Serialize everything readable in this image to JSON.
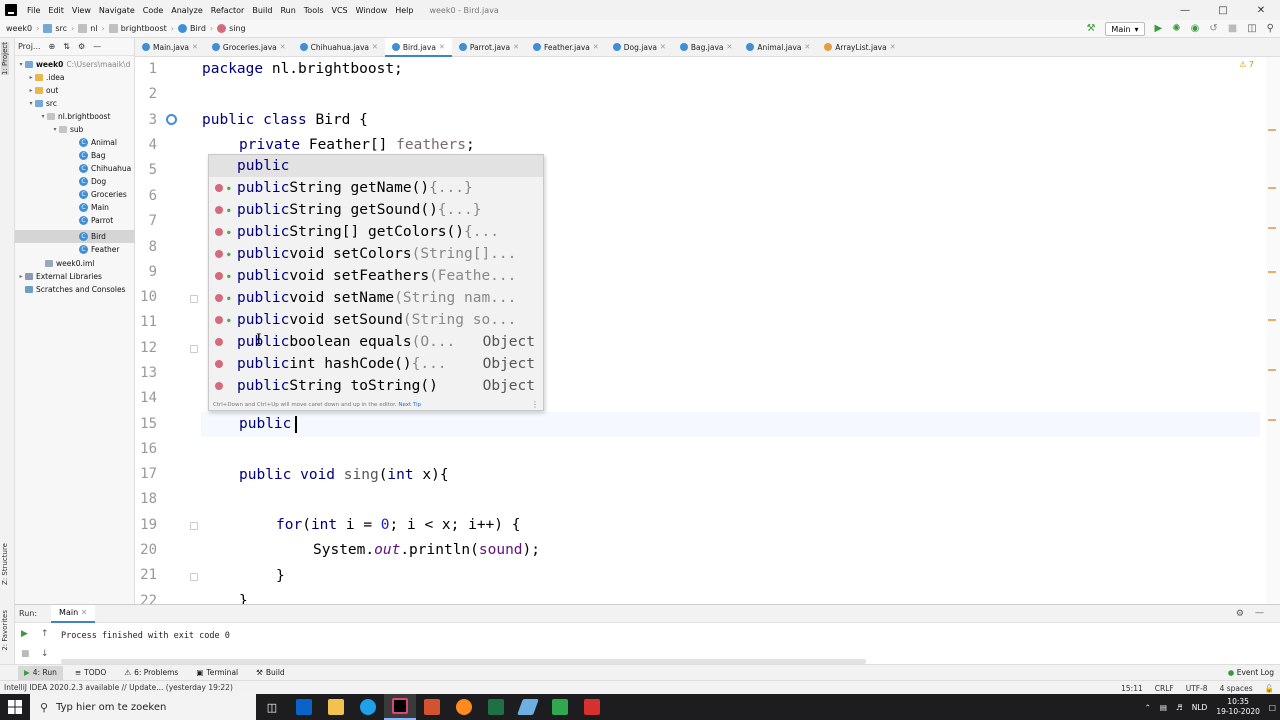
{
  "menu": {
    "items": [
      "File",
      "Edit",
      "View",
      "Navigate",
      "Code",
      "Analyze",
      "Refactor",
      "Build",
      "Run",
      "Tools",
      "VCS",
      "Window",
      "Help"
    ],
    "window_title": "week0 - Bird.java"
  },
  "navbar": {
    "crumbs": [
      "week0",
      "src",
      "nl",
      "brightboost",
      "Bird",
      "sing"
    ],
    "run_config": "Main"
  },
  "left_stripe": {
    "project": "1: Project",
    "structure": "Z: Structure",
    "favorites": "2: Favorites"
  },
  "project_panel": {
    "title": "Proj...",
    "tree": [
      {
        "label": "week0",
        "detail": "C:\\Users\\maaik\\d",
        "icon": "folder-icon"
      },
      {
        "label": ".idea",
        "icon": "folder-icon"
      },
      {
        "label": "out",
        "icon": "folder-icon"
      },
      {
        "label": "src",
        "icon": "folder-icon"
      },
      {
        "label": "nl.brightboost",
        "icon": "package-icon"
      },
      {
        "label": "sub",
        "icon": "package-icon"
      },
      {
        "label": "Animal",
        "icon": "class-icon"
      },
      {
        "label": "Bag",
        "icon": "class-icon"
      },
      {
        "label": "Chihuahua",
        "icon": "class-icon"
      },
      {
        "label": "Dog",
        "icon": "class-icon"
      },
      {
        "label": "Groceries",
        "icon": "class-icon"
      },
      {
        "label": "Main",
        "icon": "class-icon"
      },
      {
        "label": "Parrot",
        "icon": "class-icon"
      },
      {
        "label": "Bird",
        "icon": "class-icon"
      },
      {
        "label": "Feather",
        "icon": "class-icon"
      },
      {
        "label": "week0.iml",
        "icon": "module-icon"
      },
      {
        "label": "External Libraries",
        "icon": "library-icon"
      },
      {
        "label": "Scratches and Consoles",
        "icon": "scratches-icon"
      }
    ]
  },
  "editor_tabs": [
    "Main.java",
    "Groceries.java",
    "Chihuahua.java",
    "Bird.java",
    "Parrot.java",
    "Feather.java",
    "Dog.java",
    "Bag.java",
    "Animal.java",
    "ArrayList.java"
  ],
  "editor": {
    "line_numbers": [
      "1",
      "2",
      "3",
      "4",
      "5",
      "6",
      "7",
      "8",
      "9",
      "10",
      "11",
      "12",
      "13",
      "14",
      "15",
      "16",
      "17",
      "18",
      "19",
      "20",
      "21",
      "22"
    ],
    "code": {
      "l1_kw": "package",
      "l1_rest": " nl.brightboost;",
      "l3_kw": "public class",
      "l3_rest": " Bird {",
      "l4_kw": "private",
      "l4_type": " Feather[] ",
      "l4_field": "feathers",
      "l4_end": ";",
      "l15_kw": "public",
      "l17_kw": "public void",
      "l17_name": " sing",
      "l17_open": "(",
      "l17_kw2": "int",
      "l17_rest": " x){",
      "l19_kw": "for",
      "l19_open": "(",
      "l19_kw2": "int",
      "l19_mid": " i = ",
      "l19_num": "0",
      "l19_rest": "; i < x; i++) {",
      "l20_a": "System.",
      "l20_out": "out",
      "l20_b": ".println(",
      "l20_field": "sound",
      "l20_c": ");",
      "l21": "}",
      "l22": "}"
    },
    "warnings": "7"
  },
  "completion": {
    "items": [
      {
        "kw": "public",
        "sig": "",
        "tail": "",
        "type": ""
      },
      {
        "kw": "public",
        "sig": " String getName()",
        "tail": " {...}",
        "type": ""
      },
      {
        "kw": "public",
        "sig": " String getSound()",
        "tail": " {...}",
        "type": ""
      },
      {
        "kw": "public",
        "sig": " String[] getColors()",
        "tail": " {...",
        "type": ""
      },
      {
        "kw": "public",
        "sig": " void setColors",
        "tail": "(String[]...",
        "type": ""
      },
      {
        "kw": "public",
        "sig": " void setFeathers",
        "tail": "(Feathe...",
        "type": ""
      },
      {
        "kw": "public",
        "sig": " void setName",
        "tail": "(String nam...",
        "type": ""
      },
      {
        "kw": "public",
        "sig": " void setSound",
        "tail": "(String so...",
        "type": ""
      },
      {
        "kw": "public",
        "sig": " boolean equals",
        "tail": "(O...",
        "type": "Object"
      },
      {
        "kw": "public",
        "sig": " int hashCode()",
        "tail": " {...",
        "type": "Object"
      },
      {
        "kw": "public",
        "sig": " String toString()",
        "tail": "",
        "type": "Object"
      }
    ],
    "hint": "Ctrl+Down and Ctrl+Up will move caret down and up in the editor.",
    "hint_link": "Next Tip"
  },
  "run_panel": {
    "label": "Run:",
    "tab": "Main",
    "output": "Process finished with exit code 0"
  },
  "tool_windows": [
    "4: Run",
    "TODO",
    "6: Problems",
    "Terminal",
    "Build"
  ],
  "event_log": "Event Log",
  "status": {
    "message": "IntelliJ IDEA 2020.2.3 available // Update... (yesterday 19:22)",
    "position": "15:11",
    "line_sep": "CRLF",
    "encoding": "UTF-8",
    "indent": "4 spaces"
  },
  "taskbar": {
    "search_placeholder": "Typ hier om te zoeken",
    "lang": "NLD",
    "time": "10:35",
    "date": "19-10-2020"
  },
  "colors": {
    "accent": "#4083c9",
    "keyword": "#00007f",
    "method_icon": "#d46a7a",
    "class_icon": "#3f8fd6"
  }
}
